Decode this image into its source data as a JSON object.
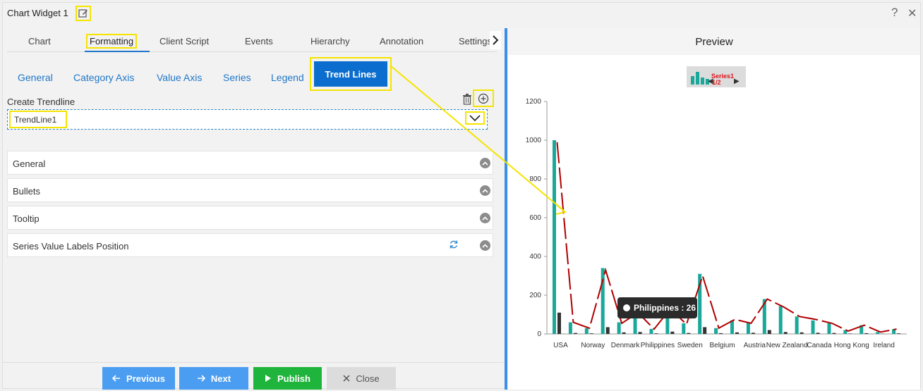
{
  "window": {
    "title": "Chart Widget 1",
    "help": "?",
    "close": "✕"
  },
  "tabs": [
    {
      "label": "Chart"
    },
    {
      "label": "Formatting"
    },
    {
      "label": "Client Script"
    },
    {
      "label": "Events"
    },
    {
      "label": "Hierarchy"
    },
    {
      "label": "Annotation"
    },
    {
      "label": "Settings"
    }
  ],
  "subtabs": [
    {
      "label": "General"
    },
    {
      "label": "Category Axis"
    },
    {
      "label": "Value Axis"
    },
    {
      "label": "Series"
    },
    {
      "label": "Legend"
    },
    {
      "label": "Trend Lines"
    }
  ],
  "trendline": {
    "label": "Create Trendline",
    "selected": "TrendLine1"
  },
  "accordion": [
    {
      "label": "General"
    },
    {
      "label": "Bullets"
    },
    {
      "label": "Tooltip"
    },
    {
      "label": "Series Value Labels Position"
    }
  ],
  "buttons": {
    "previous": "Previous",
    "next": "Next",
    "publish": "Publish",
    "close": "Close"
  },
  "preview": {
    "title": "Preview",
    "legend_name": "Series1",
    "legend_page": "1/2",
    "tooltip": "Philippines : 26"
  },
  "chart_data": {
    "type": "bar",
    "ylim": [
      0,
      1200
    ],
    "yticks": [
      0,
      200,
      400,
      600,
      800,
      1000,
      1200
    ],
    "category_labels": [
      "USA",
      "Norway",
      "Denmark",
      "Philippines",
      "Sweden",
      "Belgium",
      "Austria",
      "New Zealand",
      "Canada",
      "Hong Kong",
      "Ireland"
    ],
    "series": [
      {
        "values": [
          1000,
          60,
          30,
          340,
          60,
          120,
          26,
          140,
          55,
          310,
          30,
          70,
          60,
          180,
          145,
          90,
          70,
          55,
          20,
          45,
          10,
          25
        ]
      },
      {
        "values": [
          110,
          5,
          3,
          35,
          8,
          10,
          3,
          12,
          5,
          35,
          4,
          8,
          6,
          20,
          10,
          8,
          6,
          5,
          2,
          4,
          1,
          3
        ]
      }
    ],
    "trend_line": [
      990,
      60,
      30,
      330,
      55,
      110,
      25,
      130,
      50,
      300,
      30,
      75,
      55,
      180,
      140,
      90,
      75,
      55,
      15,
      45,
      10,
      25
    ],
    "colors": {
      "primary": "#1aa89b",
      "secondary": "#333333",
      "trend": "#b00000"
    }
  }
}
